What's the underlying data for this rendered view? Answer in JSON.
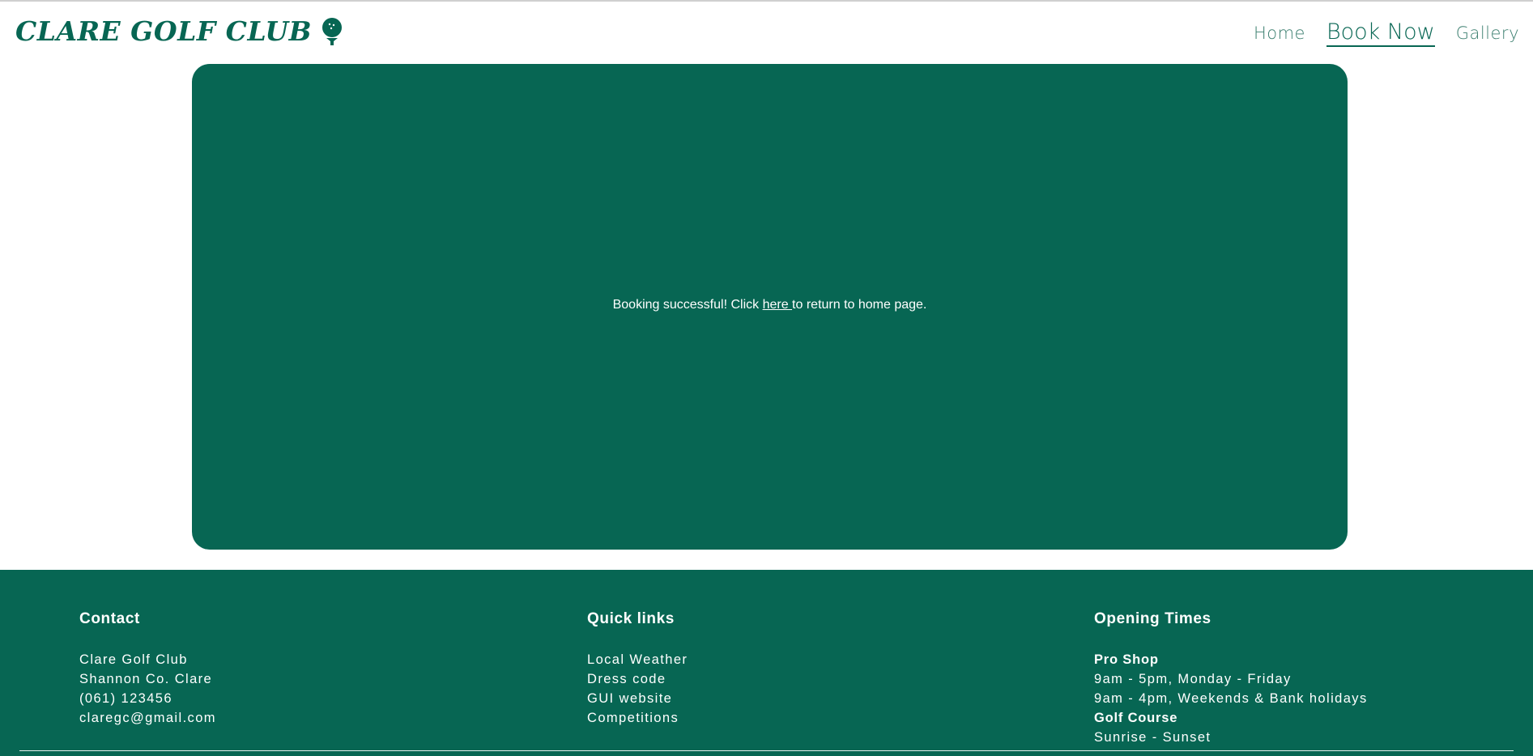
{
  "brand": {
    "title": "CLARE GOLF CLUB",
    "icon": "golf-ball-on-tee-icon",
    "color": "#076653"
  },
  "nav": {
    "items": [
      {
        "label": "Home"
      },
      {
        "label": "Book Now",
        "active": true
      },
      {
        "label": "Gallery"
      }
    ]
  },
  "panel": {
    "message_before": "Booking successful! Click ",
    "link_text": "here ",
    "message_after": "to return to home page.",
    "background": "#076653"
  },
  "footer": {
    "contact": {
      "heading": "Contact",
      "lines": [
        "Clare Golf Club",
        "Shannon Co. Clare",
        "(061) 123456",
        "claregc@gmail.com"
      ]
    },
    "quick_links": {
      "heading": "Quick links",
      "links": [
        "Local Weather",
        "Dress code",
        "GUI website",
        "Competitions"
      ]
    },
    "opening_times": {
      "heading": "Opening Times",
      "pro_shop_label": "Pro Shop",
      "pro_shop_weekday": "9am - 5pm, Monday - Friday",
      "pro_shop_weekend": "9am - 4pm, Weekends & Bank holidays",
      "course_label": "Golf Course",
      "course_hours": "Sunrise - Sunset"
    }
  }
}
